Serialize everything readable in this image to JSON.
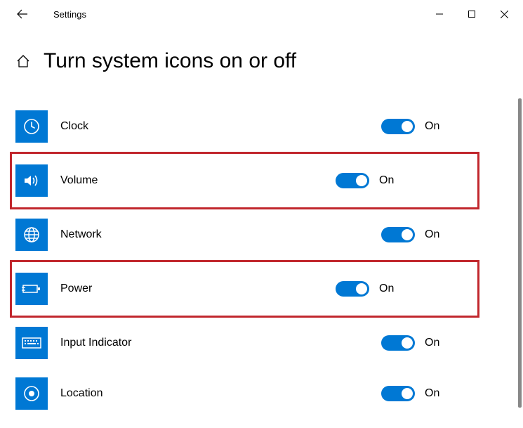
{
  "window": {
    "app_title": "Settings"
  },
  "page": {
    "title": "Turn system icons on or off"
  },
  "items": [
    {
      "label": "Clock",
      "state_label": "On",
      "state": true,
      "highlight": false,
      "icon": "clock"
    },
    {
      "label": "Volume",
      "state_label": "On",
      "state": true,
      "highlight": true,
      "icon": "volume"
    },
    {
      "label": "Network",
      "state_label": "On",
      "state": true,
      "highlight": false,
      "icon": "network"
    },
    {
      "label": "Power",
      "state_label": "On",
      "state": true,
      "highlight": true,
      "icon": "power"
    },
    {
      "label": "Input Indicator",
      "state_label": "On",
      "state": true,
      "highlight": false,
      "icon": "keyboard"
    },
    {
      "label": "Location",
      "state_label": "On",
      "state": true,
      "highlight": false,
      "icon": "location"
    }
  ]
}
